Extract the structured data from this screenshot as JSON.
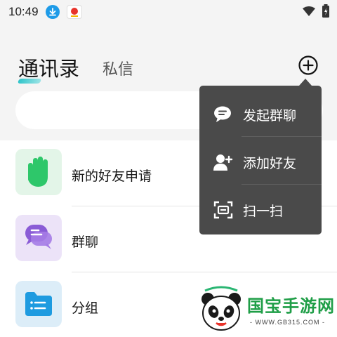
{
  "status_bar": {
    "time": "10:49",
    "icons": [
      "download-icon",
      "app-notification-icon",
      "wifi-icon",
      "battery-icon"
    ]
  },
  "header": {
    "tabs": [
      {
        "label": "通讯录",
        "active": true
      },
      {
        "label": "私信",
        "active": false
      }
    ],
    "accent": "#2ec4c9",
    "add_icon": "plus-circle-icon"
  },
  "search": {
    "placeholder": ""
  },
  "list": {
    "items": [
      {
        "label": "新的好友申请",
        "icon": "waving-hand-icon",
        "color": "#2ec76a",
        "bg": "#e3f5e8"
      },
      {
        "label": "群聊",
        "icon": "group-chat-icon",
        "color": "#8a5cd6",
        "bg": "#ece3f8"
      },
      {
        "label": "分组",
        "icon": "folder-list-icon",
        "color": "#1e9be0",
        "bg": "#dcedf8"
      }
    ]
  },
  "popup_menu": {
    "items": [
      {
        "label": "发起群聊",
        "icon": "start-group-chat-icon"
      },
      {
        "label": "添加好友",
        "icon": "add-friend-icon"
      },
      {
        "label": "扫一扫",
        "icon": "scan-icon"
      }
    ],
    "background": "#4a4a4a"
  },
  "watermark": {
    "brand": "国宝手游网",
    "url": "- WWW.GB315.COM -",
    "brand_color": "#1f9e47"
  }
}
